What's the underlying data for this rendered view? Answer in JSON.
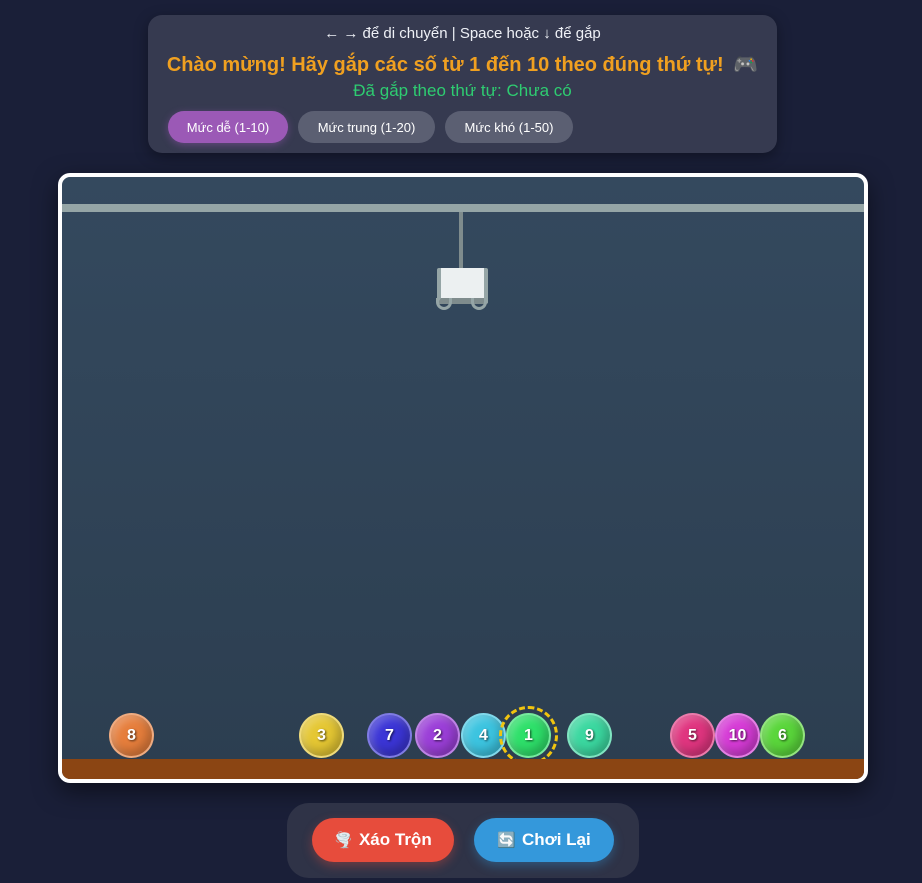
{
  "header": {
    "instructions": "← → để di chuyển | Space hoặc ↓ để gắp",
    "message": "Chào mừng! Hãy gắp các số từ 1 đến 10 theo đúng thứ tự!",
    "message_icon": "🎮",
    "progress": "Đã gắp theo thứ tự: Chưa có"
  },
  "levels": [
    {
      "label": "Mức dễ (1-10)",
      "active": true
    },
    {
      "label": "Mức trung (1-20)",
      "active": false
    },
    {
      "label": "Mức khó (1-50)",
      "active": false
    }
  ],
  "balls": [
    {
      "number": "8",
      "color": "#e67e3c"
    },
    {
      "number": "3",
      "color": "#e5c733"
    },
    {
      "number": "7",
      "color": "#3b35d6"
    },
    {
      "number": "2",
      "color": "#9b3fd8"
    },
    {
      "number": "4",
      "color": "#3cc4e0"
    },
    {
      "number": "1",
      "color": "#2ee06a",
      "target": true
    },
    {
      "number": "9",
      "color": "#3bd8a0"
    },
    {
      "number": "5",
      "color": "#e0357f"
    },
    {
      "number": "10",
      "color": "#d63bd6"
    },
    {
      "number": "6",
      "color": "#5ad63b"
    }
  ],
  "actions": {
    "shuffle_icon": "🌪️",
    "shuffle_label": "Xáo Trộn",
    "reset_icon": "🔄",
    "reset_label": "Chơi Lại"
  }
}
